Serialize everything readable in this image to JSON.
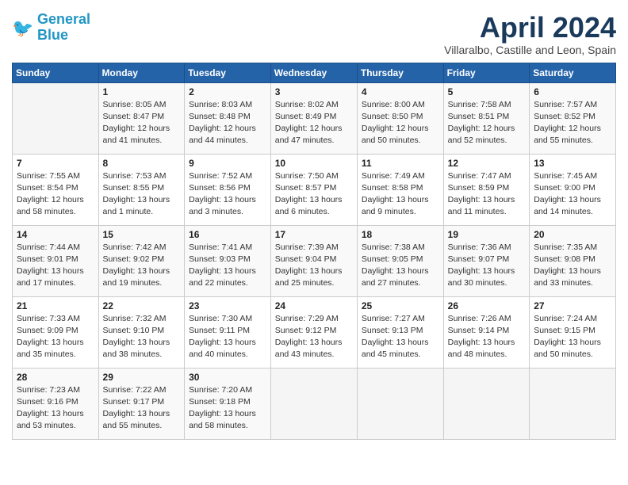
{
  "logo": {
    "line1": "General",
    "line2": "Blue"
  },
  "title": "April 2024",
  "location": "Villaralbo, Castille and Leon, Spain",
  "weekdays": [
    "Sunday",
    "Monday",
    "Tuesday",
    "Wednesday",
    "Thursday",
    "Friday",
    "Saturday"
  ],
  "weeks": [
    [
      {
        "day": "",
        "info": ""
      },
      {
        "day": "1",
        "info": "Sunrise: 8:05 AM\nSunset: 8:47 PM\nDaylight: 12 hours\nand 41 minutes."
      },
      {
        "day": "2",
        "info": "Sunrise: 8:03 AM\nSunset: 8:48 PM\nDaylight: 12 hours\nand 44 minutes."
      },
      {
        "day": "3",
        "info": "Sunrise: 8:02 AM\nSunset: 8:49 PM\nDaylight: 12 hours\nand 47 minutes."
      },
      {
        "day": "4",
        "info": "Sunrise: 8:00 AM\nSunset: 8:50 PM\nDaylight: 12 hours\nand 50 minutes."
      },
      {
        "day": "5",
        "info": "Sunrise: 7:58 AM\nSunset: 8:51 PM\nDaylight: 12 hours\nand 52 minutes."
      },
      {
        "day": "6",
        "info": "Sunrise: 7:57 AM\nSunset: 8:52 PM\nDaylight: 12 hours\nand 55 minutes."
      }
    ],
    [
      {
        "day": "7",
        "info": "Sunrise: 7:55 AM\nSunset: 8:54 PM\nDaylight: 12 hours\nand 58 minutes."
      },
      {
        "day": "8",
        "info": "Sunrise: 7:53 AM\nSunset: 8:55 PM\nDaylight: 13 hours\nand 1 minute."
      },
      {
        "day": "9",
        "info": "Sunrise: 7:52 AM\nSunset: 8:56 PM\nDaylight: 13 hours\nand 3 minutes."
      },
      {
        "day": "10",
        "info": "Sunrise: 7:50 AM\nSunset: 8:57 PM\nDaylight: 13 hours\nand 6 minutes."
      },
      {
        "day": "11",
        "info": "Sunrise: 7:49 AM\nSunset: 8:58 PM\nDaylight: 13 hours\nand 9 minutes."
      },
      {
        "day": "12",
        "info": "Sunrise: 7:47 AM\nSunset: 8:59 PM\nDaylight: 13 hours\nand 11 minutes."
      },
      {
        "day": "13",
        "info": "Sunrise: 7:45 AM\nSunset: 9:00 PM\nDaylight: 13 hours\nand 14 minutes."
      }
    ],
    [
      {
        "day": "14",
        "info": "Sunrise: 7:44 AM\nSunset: 9:01 PM\nDaylight: 13 hours\nand 17 minutes."
      },
      {
        "day": "15",
        "info": "Sunrise: 7:42 AM\nSunset: 9:02 PM\nDaylight: 13 hours\nand 19 minutes."
      },
      {
        "day": "16",
        "info": "Sunrise: 7:41 AM\nSunset: 9:03 PM\nDaylight: 13 hours\nand 22 minutes."
      },
      {
        "day": "17",
        "info": "Sunrise: 7:39 AM\nSunset: 9:04 PM\nDaylight: 13 hours\nand 25 minutes."
      },
      {
        "day": "18",
        "info": "Sunrise: 7:38 AM\nSunset: 9:05 PM\nDaylight: 13 hours\nand 27 minutes."
      },
      {
        "day": "19",
        "info": "Sunrise: 7:36 AM\nSunset: 9:07 PM\nDaylight: 13 hours\nand 30 minutes."
      },
      {
        "day": "20",
        "info": "Sunrise: 7:35 AM\nSunset: 9:08 PM\nDaylight: 13 hours\nand 33 minutes."
      }
    ],
    [
      {
        "day": "21",
        "info": "Sunrise: 7:33 AM\nSunset: 9:09 PM\nDaylight: 13 hours\nand 35 minutes."
      },
      {
        "day": "22",
        "info": "Sunrise: 7:32 AM\nSunset: 9:10 PM\nDaylight: 13 hours\nand 38 minutes."
      },
      {
        "day": "23",
        "info": "Sunrise: 7:30 AM\nSunset: 9:11 PM\nDaylight: 13 hours\nand 40 minutes."
      },
      {
        "day": "24",
        "info": "Sunrise: 7:29 AM\nSunset: 9:12 PM\nDaylight: 13 hours\nand 43 minutes."
      },
      {
        "day": "25",
        "info": "Sunrise: 7:27 AM\nSunset: 9:13 PM\nDaylight: 13 hours\nand 45 minutes."
      },
      {
        "day": "26",
        "info": "Sunrise: 7:26 AM\nSunset: 9:14 PM\nDaylight: 13 hours\nand 48 minutes."
      },
      {
        "day": "27",
        "info": "Sunrise: 7:24 AM\nSunset: 9:15 PM\nDaylight: 13 hours\nand 50 minutes."
      }
    ],
    [
      {
        "day": "28",
        "info": "Sunrise: 7:23 AM\nSunset: 9:16 PM\nDaylight: 13 hours\nand 53 minutes."
      },
      {
        "day": "29",
        "info": "Sunrise: 7:22 AM\nSunset: 9:17 PM\nDaylight: 13 hours\nand 55 minutes."
      },
      {
        "day": "30",
        "info": "Sunrise: 7:20 AM\nSunset: 9:18 PM\nDaylight: 13 hours\nand 58 minutes."
      },
      {
        "day": "",
        "info": ""
      },
      {
        "day": "",
        "info": ""
      },
      {
        "day": "",
        "info": ""
      },
      {
        "day": "",
        "info": ""
      }
    ]
  ]
}
